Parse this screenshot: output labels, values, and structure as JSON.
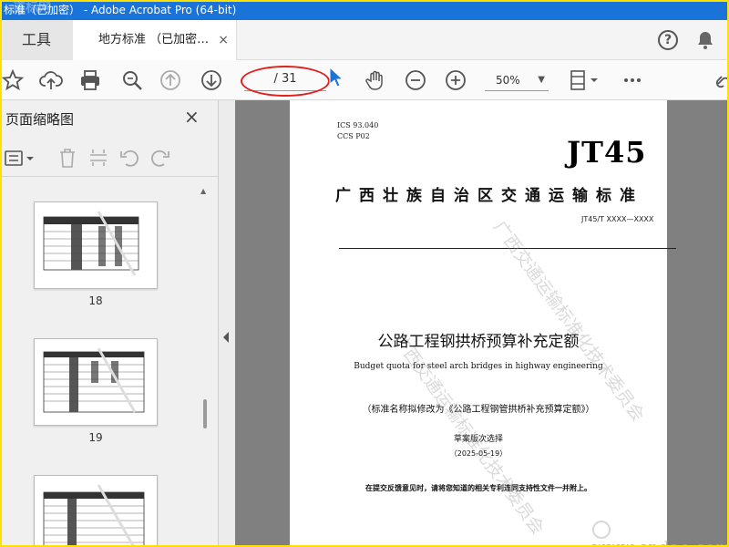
{
  "window": {
    "title": "标准（已加密） - Adobe Acrobat Pro (64-bit)",
    "overlay_text": "道标网"
  },
  "tabs": {
    "tools": "工具",
    "document": "地方标准 （已加密…",
    "close": "×",
    "help": "?"
  },
  "toolbar": {
    "page_indicator": "/ 31",
    "zoom": "50%"
  },
  "thumbnails_pane": {
    "title": "页面缩略图",
    "close": "×",
    "pages": [
      {
        "label": "18"
      },
      {
        "label": "19"
      }
    ]
  },
  "document": {
    "ics": "ICS  93.040",
    "ccs": "CCS  P02",
    "logo": "JT45",
    "standard_type": "广西壮族自治区交通运输标准",
    "code": "JT45/T XXXX—XXXX",
    "title_cn": "公路工程钢拱桥预算补充定额",
    "title_en": "Budget quota for steel arch bridges in highway engineering",
    "rename_note": "（标准名称拟修改为《公路工程钢管拱桥补充预算定额》）",
    "draft": "草案版次选择",
    "date": "（2025-05-19）",
    "feedback_note": "在提交反馈意见时，请将您知道的相关专利连同支持性文件一并附上。",
    "watermark": "广西交通运输标准化技术委员会"
  },
  "site_watermark": "www.cndao.com",
  "colors": {
    "title_bar": "#1a73d9",
    "frame": "#ffe100",
    "annotation": "#e0201c",
    "cursor": "#1a73d9"
  }
}
